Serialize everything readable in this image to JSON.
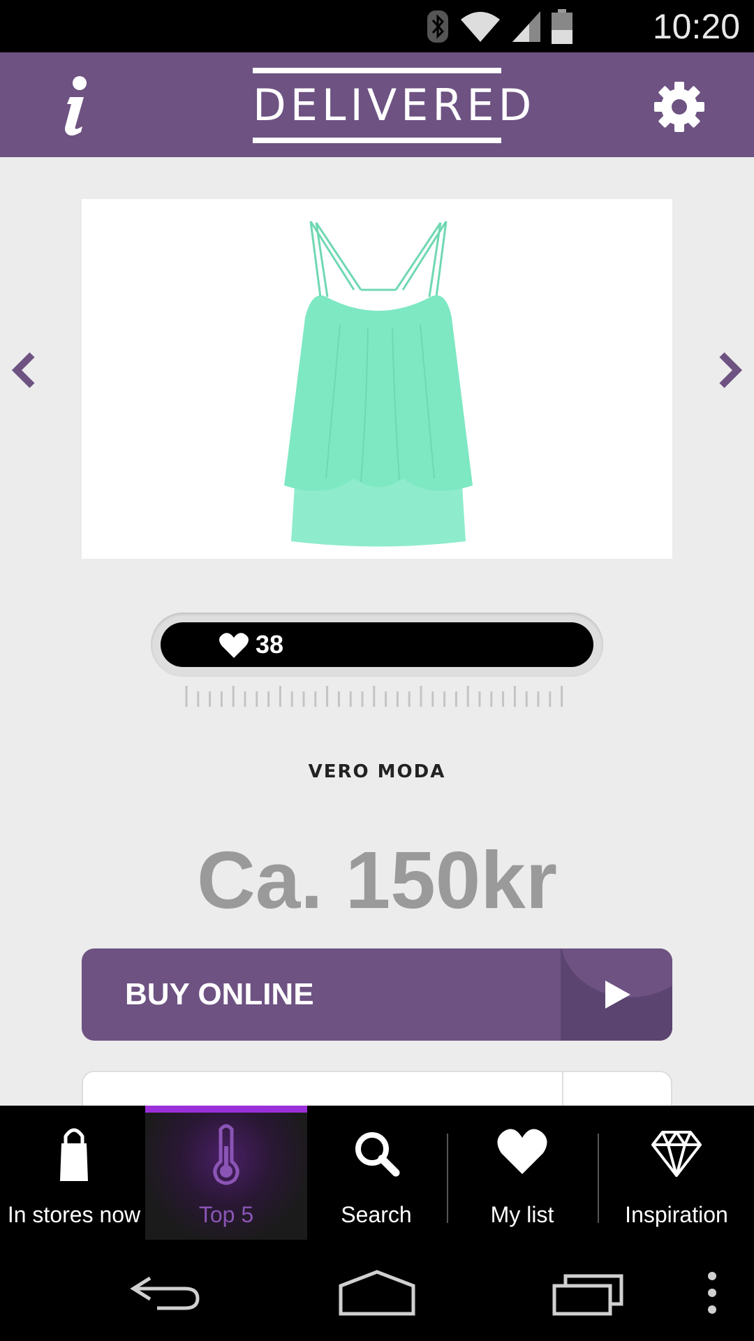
{
  "status_bar": {
    "time": "10:20",
    "icons": [
      "bluetooth-icon",
      "wifi-icon",
      "cell-signal-icon",
      "battery-icon"
    ]
  },
  "app_bar": {
    "logo_text": "DELIVERED",
    "left_icon": "info-icon",
    "right_icon": "gear-icon"
  },
  "product": {
    "image_alt": "mint green ruffled strappy top",
    "likes": "38",
    "brand": "VERO MODA",
    "price": "Ca. 150kr",
    "buy_label": "BUY ONLINE"
  },
  "tabs": [
    {
      "label": "In stores now",
      "icon": "shopping-bag-icon",
      "active": false
    },
    {
      "label": "Top 5",
      "icon": "thermometer-icon",
      "active": true
    },
    {
      "label": "Search",
      "icon": "search-icon",
      "active": false
    },
    {
      "label": "My list",
      "icon": "heart-icon",
      "active": false
    },
    {
      "label": "Inspiration",
      "icon": "diamond-icon",
      "active": false
    }
  ],
  "colors": {
    "brand_purple": "#6d5282",
    "active_tab_accent": "#9b30d9",
    "active_tab_text": "#8a55b5",
    "product_color": "#7ee8c3"
  }
}
